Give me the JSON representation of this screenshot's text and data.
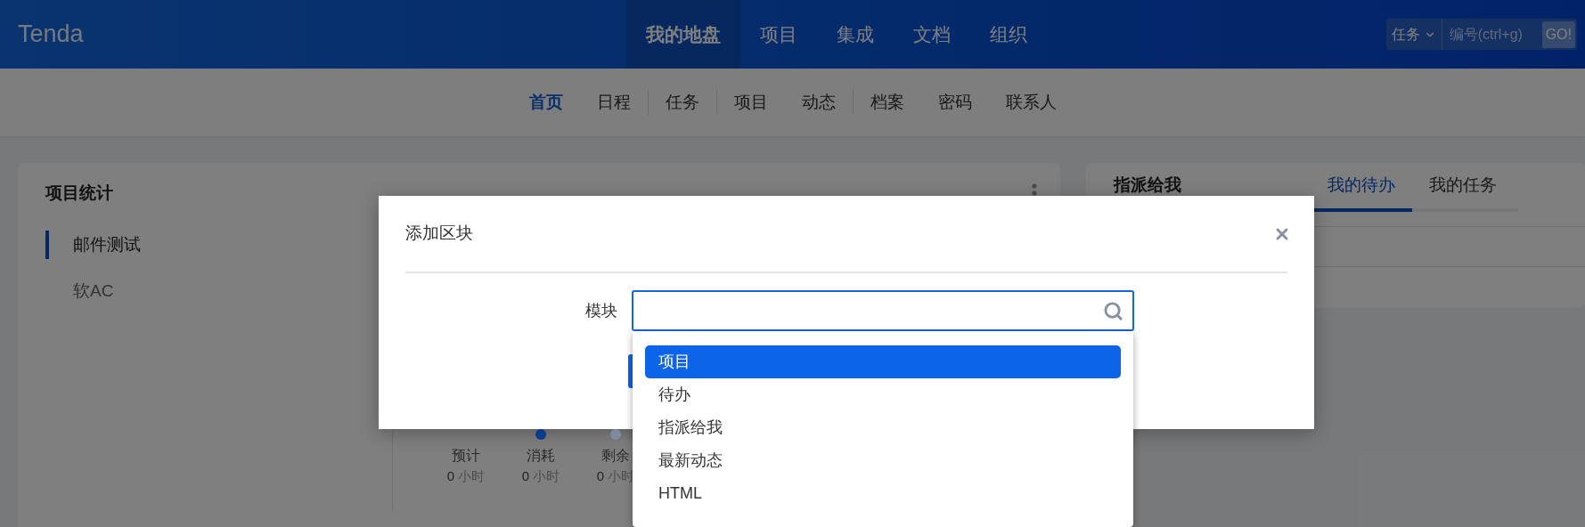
{
  "header": {
    "logo": "Tenda",
    "nav": [
      {
        "label": "我的地盘",
        "selected": true
      },
      {
        "label": "项目",
        "selected": false
      },
      {
        "label": "集成",
        "selected": false
      },
      {
        "label": "文档",
        "selected": false
      },
      {
        "label": "组织",
        "selected": false
      }
    ],
    "search": {
      "type": "任务",
      "placeholder": "编号(ctrl+g)",
      "button": "GO!"
    }
  },
  "subnav": {
    "groups": [
      [
        {
          "label": "首页",
          "selected": true
        },
        {
          "label": "日程",
          "selected": false
        }
      ],
      [
        {
          "label": "任务",
          "selected": false
        }
      ],
      [
        {
          "label": "项目",
          "selected": false
        },
        {
          "label": "动态",
          "selected": false
        }
      ],
      [
        {
          "label": "档案",
          "selected": false
        },
        {
          "label": "密码",
          "selected": false
        },
        {
          "label": "联系人",
          "selected": false
        }
      ]
    ]
  },
  "project_stats": {
    "title": "项目统计",
    "projects": [
      {
        "name": "邮件测试",
        "selected": true
      },
      {
        "name": "软AC",
        "selected": false
      }
    ],
    "legend": [
      {
        "label": "预计",
        "value": "0",
        "unit": "小时"
      },
      {
        "label": "消耗",
        "value": "0",
        "unit": "小时",
        "color": "#0a3b8a"
      },
      {
        "label": "剩余",
        "value": "0",
        "unit": "小时",
        "color": "#7d8ba0"
      }
    ]
  },
  "assigned": {
    "title": "指派给我",
    "tabs": [
      {
        "label": "我的待办",
        "selected": true
      },
      {
        "label": "我的任务",
        "selected": false
      }
    ]
  },
  "dialog": {
    "title": "添加区块",
    "field_label": "模块",
    "options": [
      {
        "label": "项目",
        "selected": true
      },
      {
        "label": "待办",
        "selected": false
      },
      {
        "label": "指派给我",
        "selected": false
      },
      {
        "label": "最新动态",
        "selected": false
      },
      {
        "label": "HTML",
        "selected": false
      }
    ]
  }
}
